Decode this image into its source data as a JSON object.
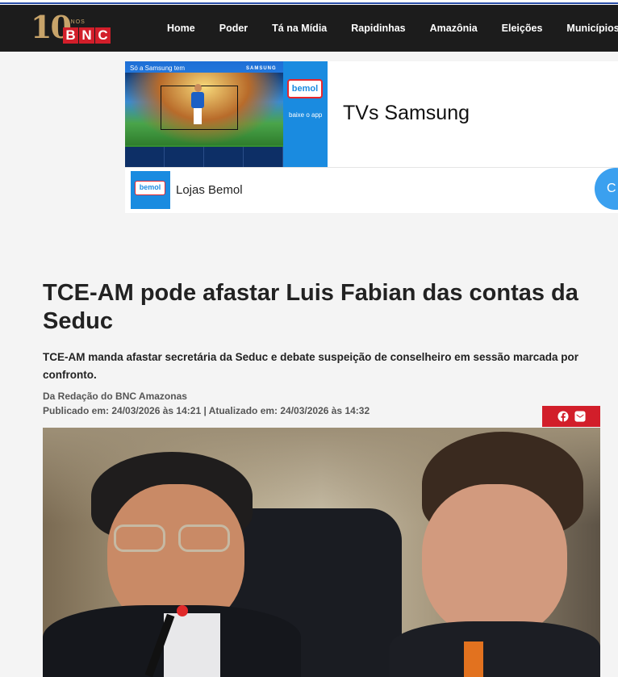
{
  "site": {
    "logo_years": "10",
    "logo_anos": "ANOS",
    "logo_letters": [
      "B",
      "N",
      "C"
    ]
  },
  "nav": {
    "items": [
      "Home",
      "Poder",
      "Tá na Mídia",
      "Rapidinhas",
      "Amazônia",
      "Eleições",
      "Municípios"
    ]
  },
  "ad": {
    "banner_tagline": "Só a Samsung tem",
    "banner_brand": "SAMSUNG",
    "bemol_logo": "bemol",
    "app_text": "baixe o app",
    "title": "TVs Samsung",
    "store_name": "Lojas Bemol",
    "cta_label": "C"
  },
  "article": {
    "headline": "TCE-AM pode afastar Luis Fabian das contas da Seduc",
    "lead": "TCE-AM manda afastar secretária da Seduc e debate suspeição de conselheiro em sessão marcada por confronto.",
    "byline": "Da Redação do BNC Amazonas",
    "dates": "Publicado em: 24/03/2026 às 14:21 | Atualizado em: 24/03/2026 às 14:32"
  },
  "share": {
    "icons": [
      "facebook-icon",
      "twitter-icon"
    ]
  },
  "colors": {
    "nav_bg": "#1c1c1c",
    "brand_red": "#d21e2a",
    "logo_gold": "#c8a46a",
    "bemol_blue": "#1a8be0"
  }
}
